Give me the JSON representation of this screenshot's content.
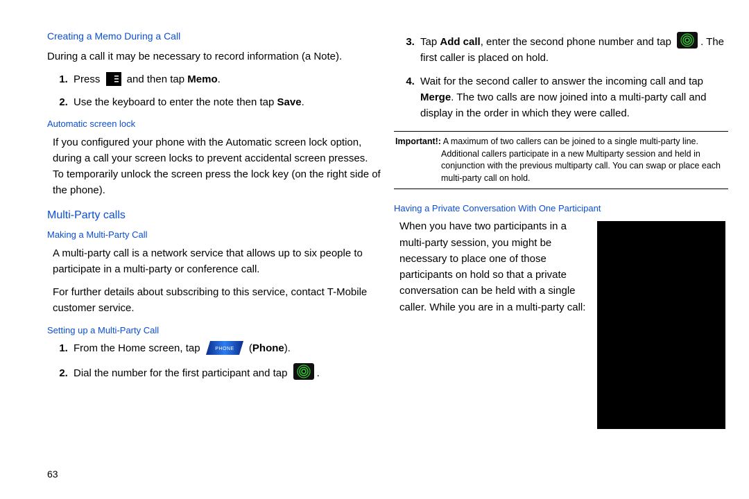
{
  "pageNumber": "63",
  "left": {
    "h_memo": "Creating a Memo During a Call",
    "p_memo_intro": "During a call it may be necessary to record information (a Note).",
    "memo_step1_a": "Press ",
    "memo_step1_b": " and then tap ",
    "memo_label": "Memo",
    "memo_step1_c": ".",
    "memo_step2_a": "Use the keyboard to enter the note then tap ",
    "save_label": "Save",
    "memo_step2_b": ".",
    "h_autolock": "Automatic screen lock",
    "p_autolock": "If you configured your phone with the Automatic screen lock option, during a call your screen locks to prevent accidental screen presses. To temporarily unlock the screen press the lock key (on the right side of the phone).",
    "h_multi": "Multi-Party calls",
    "h_making": "Making a Multi-Party Call",
    "p_making1": "A multi-party call is a network service that allows up to six people to participate in a multi-party or conference call.",
    "p_making2": "For further details about subscribing to this service, contact T-Mobile customer service.",
    "h_setup": "Setting up a Multi-Party Call",
    "setup1_a": "From the Home screen, tap ",
    "setup1_b": " (",
    "phone_label": "Phone",
    "setup1_c": ").",
    "setup2_a": "Dial the number for the first participant and tap ",
    "setup2_b": "."
  },
  "right": {
    "step3_a": "Tap ",
    "addcall_label": "Add call",
    "step3_b": ", enter the second phone number and tap ",
    "step3_c": ". The first caller is placed on hold.",
    "step4_a": "Wait for the second caller to answer the incoming call and tap ",
    "merge_label": "Merge",
    "step4_b": ". The two calls are now joined into a multi-party call and display in the order in which they were called.",
    "note_label": "Important!:",
    "note_text": " A maximum of two callers can be joined to a single multi-party line. Additional callers participate in a new Multiparty session and held in conjunction with the previous multiparty call. You can swap or place each multi-party call on hold.",
    "h_private": "Having a Private Conversation With One Participant",
    "p_private": "When you have two participants in a multi-party session, you might be necessary to place one of those participants on hold so that a private conversation can be held with a single caller. While you are in a multi-party call:"
  },
  "icons": {
    "hamburger": "menu-icon",
    "phone": "PHONE",
    "dial": "dial-icon"
  }
}
